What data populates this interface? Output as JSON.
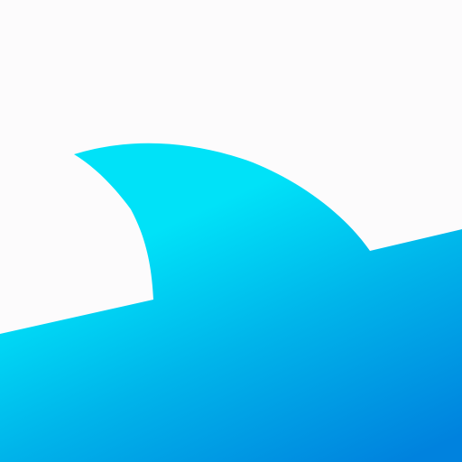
{
  "icon": {
    "name": "shark-fin-wave",
    "background_color": "#FCFBFC",
    "gradient_top_color": "#00E2F8",
    "gradient_mid_color": "#00B4EA",
    "gradient_bottom_color": "#0082DE"
  }
}
